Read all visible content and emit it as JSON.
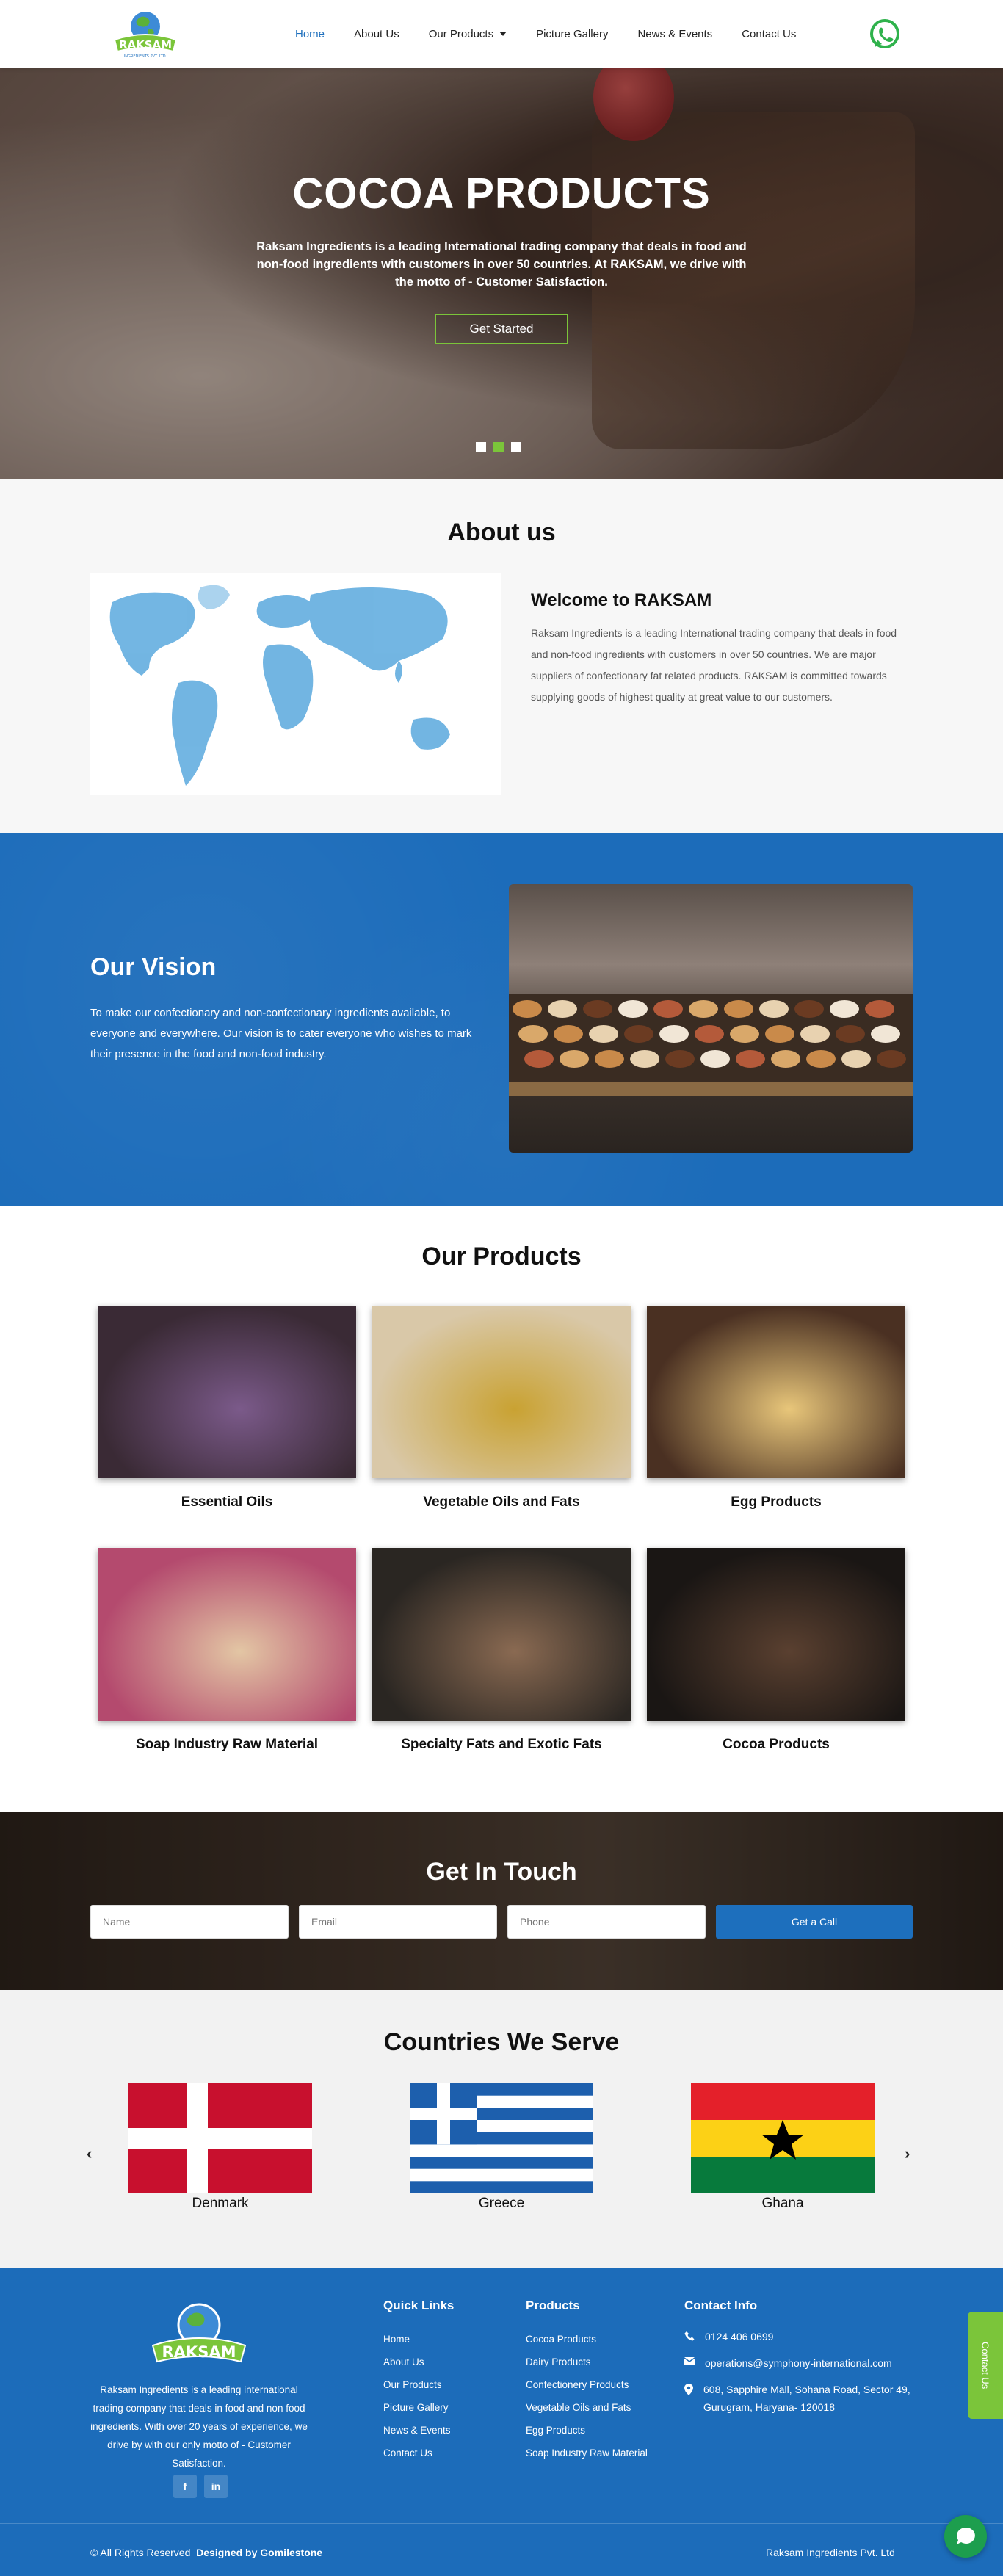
{
  "header": {
    "logo_text": "RAKSAM",
    "logo_sub": "INGREDIENTS PVT. LTD.",
    "nav": [
      "Home",
      "About Us",
      "Our Products",
      "Picture Gallery",
      "News & Events",
      "Contact Us"
    ],
    "active": "Home",
    "whatsapp_icon": "whatsapp-icon"
  },
  "hero": {
    "title": "COCOA PRODUCTS",
    "text": "Raksam Ingredients is a leading International trading company that deals in food and non-food ingredients with customers in over 50 countries. At RAKSAM, we drive with the motto of - Customer Satisfaction.",
    "button": "Get Started",
    "slides": 3,
    "active_slide": 2
  },
  "about": {
    "title": "About us",
    "subtitle": "Welcome to RAKSAM",
    "text": "Raksam Ingredients is a leading International trading company that deals in food and non-food ingredients with customers in over 50 countries. We are major suppliers of confectionary fat related products. RAKSAM is committed towards supplying goods of highest quality at great value to our customers."
  },
  "vision": {
    "title": "Our Vision",
    "text": "To make our confectionary and non-confectionary ingredients available, to everyone and everywhere. Our vision is to cater everyone who wishes to mark their presence in the food and non-food industry."
  },
  "products": {
    "title": "Our Products",
    "items": [
      {
        "name": "Essential Oils",
        "c1": "#3a2a35",
        "c2": "#7b5a8a"
      },
      {
        "name": "Vegetable Oils and Fats",
        "c1": "#d9c8a8",
        "c2": "#c9a232"
      },
      {
        "name": "Egg Products",
        "c1": "#4a3022",
        "c2": "#e8c67a"
      },
      {
        "name": "Soap Industry Raw Material",
        "c1": "#b44a6e",
        "c2": "#e3c6a4"
      },
      {
        "name": "Specialty Fats and Exotic Fats",
        "c1": "#2a2622",
        "c2": "#8a6a52"
      },
      {
        "name": "Cocoa Products",
        "c1": "#1a1614",
        "c2": "#5a4030"
      }
    ]
  },
  "touch": {
    "title": "Get In Touch",
    "name_placeholder": "Name",
    "email_placeholder": "Email",
    "phone_placeholder": "Phone",
    "button": "Get a Call"
  },
  "countries": {
    "title": "Countries We Serve",
    "items": [
      "Denmark",
      "Greece",
      "Ghana"
    ]
  },
  "footer": {
    "about": "Raksam Ingredients is a leading international trading company that deals in food and non food ingredients. With over 20 years of experience, we drive by with our only motto of - Customer Satisfaction.",
    "social": [
      "f",
      "in"
    ],
    "quick_title": "Quick Links",
    "quick_links": [
      "Home",
      "About Us",
      "Our Products",
      "Picture Gallery",
      "News & Events",
      "Contact Us"
    ],
    "products_title": "Products",
    "product_links": [
      "Cocoa Products",
      "Dairy Products",
      "Confectionery Products",
      "Vegetable Oils and Fats",
      "Egg Products",
      "Soap Industry Raw Material"
    ],
    "contact_title": "Contact Info",
    "phone": "0124 406 0699",
    "email": "operations@symphony-international.com",
    "address": "608, Sapphire Mall, Sohana Road, Sector 49, Gurugram, Haryana- 120018",
    "copyright": "© All Rights Reserved",
    "designed_by": "Designed by Gomilestone",
    "company": "Raksam Ingredients Pvt. Ltd",
    "contact_tab": "Contact Us"
  },
  "colors": {
    "primary": "#1c6cba",
    "accent": "#7bc53a"
  }
}
